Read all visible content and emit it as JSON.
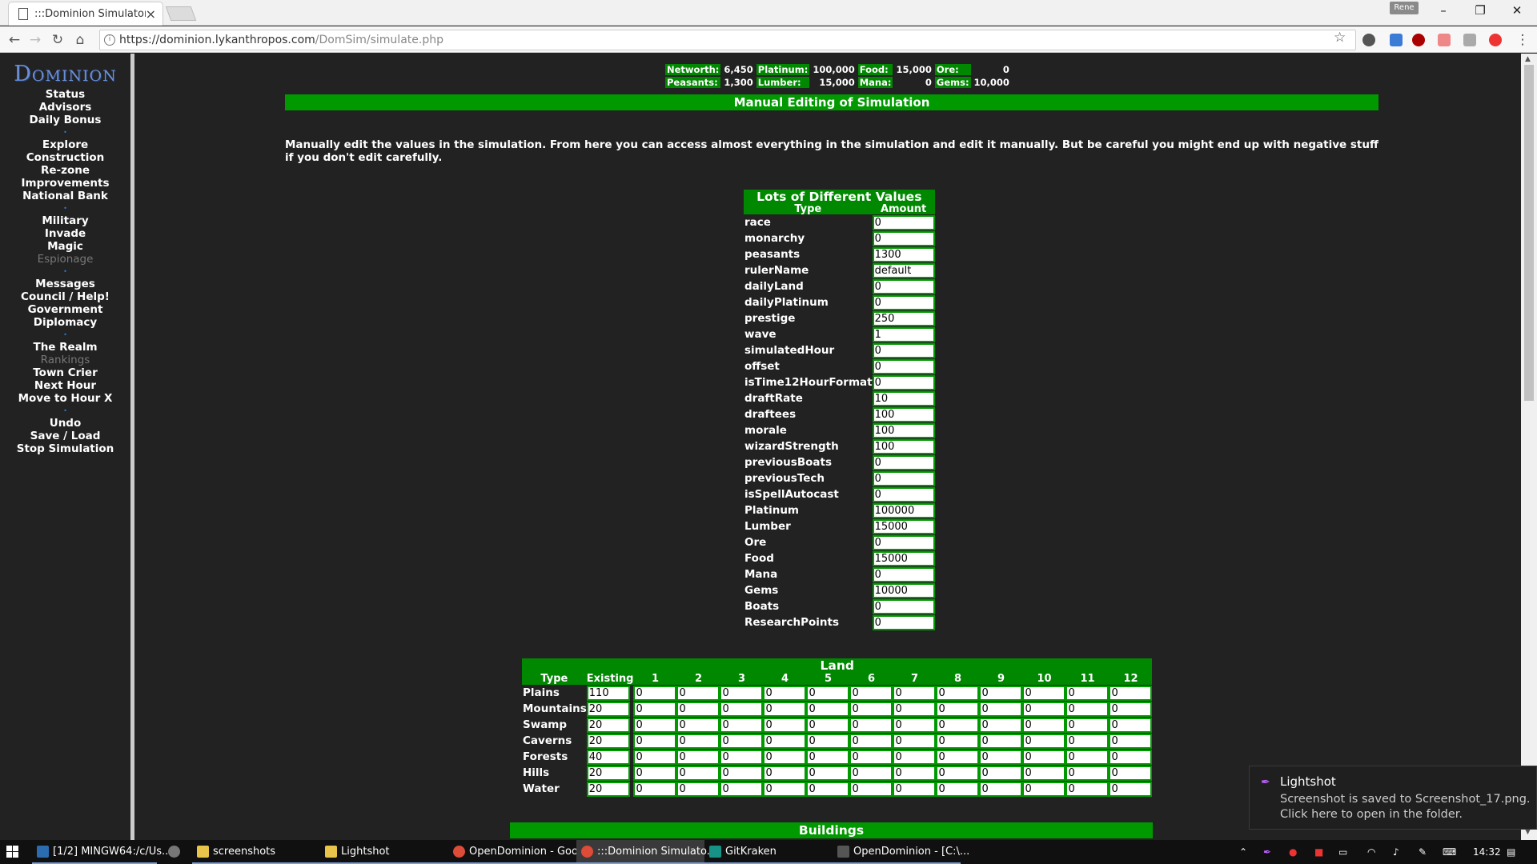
{
  "browser": {
    "tab_title": ":::Dominion Simulator:::",
    "tab_close": "×",
    "profile": "Rene",
    "url_host": "https://dominion.lykanthropos.com",
    "url_path": "/DomSim/simulate.php",
    "minimize": "–",
    "maximize": "❐",
    "close": "✕"
  },
  "sidebar": {
    "logo": "Dominion",
    "items": [
      "Status",
      "Advisors",
      "Daily Bonus",
      "Explore",
      "Construction",
      "Re-zone",
      "Improvements",
      "National Bank",
      "Military",
      "Invade",
      "Magic",
      "Espionage",
      "Messages",
      "Council / Help!",
      "Government",
      "Diplomacy",
      "The Realm",
      "Rankings",
      "Town Crier",
      "Next Hour",
      "Move to Hour X",
      "Undo",
      "Save / Load",
      "Stop Simulation"
    ]
  },
  "stats": {
    "networth_label": "Networth:",
    "networth": "6,450",
    "platinum_label": "Platinum:",
    "platinum": "100,000",
    "food_label": "Food:",
    "food": "15,000",
    "ore_label": "Ore:",
    "ore": "0",
    "peasants_label": "Peasants:",
    "peasants": "1,300",
    "lumber_label": "Lumber:",
    "lumber": "15,000",
    "mana_label": "Mana:",
    "mana": "0",
    "gems_label": "Gems:",
    "gems": "10,000"
  },
  "page": {
    "title": "Manual Editing of Simulation",
    "intro": "Manually edit the values in the simulation. From here you can access almost everything in the simulation and edit it manually. But be careful you might end up with negative stuff if you don't edit carefully."
  },
  "values_table": {
    "title": "Lots of Different Values",
    "col_type": "Type",
    "col_amount": "Amount",
    "rows": [
      {
        "name": "race",
        "value": "0"
      },
      {
        "name": "monarchy",
        "value": "0"
      },
      {
        "name": "peasants",
        "value": "1300"
      },
      {
        "name": "rulerName",
        "value": "default"
      },
      {
        "name": "dailyLand",
        "value": "0"
      },
      {
        "name": "dailyPlatinum",
        "value": "0"
      },
      {
        "name": "prestige",
        "value": "250"
      },
      {
        "name": "wave",
        "value": "1"
      },
      {
        "name": "simulatedHour",
        "value": "0"
      },
      {
        "name": "offset",
        "value": "0"
      },
      {
        "name": "isTime12HourFormat",
        "value": "0"
      },
      {
        "name": "draftRate",
        "value": "10"
      },
      {
        "name": "draftees",
        "value": "100"
      },
      {
        "name": "morale",
        "value": "100"
      },
      {
        "name": "wizardStrength",
        "value": "100"
      },
      {
        "name": "previousBoats",
        "value": "0"
      },
      {
        "name": "previousTech",
        "value": "0"
      },
      {
        "name": "isSpellAutocast",
        "value": "0"
      },
      {
        "name": "Platinum",
        "value": "100000"
      },
      {
        "name": "Lumber",
        "value": "15000"
      },
      {
        "name": "Ore",
        "value": "0"
      },
      {
        "name": "Food",
        "value": "15000"
      },
      {
        "name": "Mana",
        "value": "0"
      },
      {
        "name": "Gems",
        "value": "10000"
      },
      {
        "name": "Boats",
        "value": "0"
      },
      {
        "name": "ResearchPoints",
        "value": "0"
      }
    ]
  },
  "land_table": {
    "title": "Land",
    "headers": [
      "Type",
      "Existing",
      "1",
      "2",
      "3",
      "4",
      "5",
      "6",
      "7",
      "8",
      "9",
      "10",
      "11",
      "12"
    ],
    "rows": [
      {
        "name": "Plains",
        "values": [
          "110",
          "0",
          "0",
          "0",
          "0",
          "0",
          "0",
          "0",
          "0",
          "0",
          "0",
          "0",
          "0"
        ]
      },
      {
        "name": "Mountains",
        "values": [
          "20",
          "0",
          "0",
          "0",
          "0",
          "0",
          "0",
          "0",
          "0",
          "0",
          "0",
          "0",
          "0"
        ]
      },
      {
        "name": "Swamp",
        "values": [
          "20",
          "0",
          "0",
          "0",
          "0",
          "0",
          "0",
          "0",
          "0",
          "0",
          "0",
          "0",
          "0"
        ]
      },
      {
        "name": "Caverns",
        "values": [
          "20",
          "0",
          "0",
          "0",
          "0",
          "0",
          "0",
          "0",
          "0",
          "0",
          "0",
          "0",
          "0"
        ]
      },
      {
        "name": "Forests",
        "values": [
          "40",
          "0",
          "0",
          "0",
          "0",
          "0",
          "0",
          "0",
          "0",
          "0",
          "0",
          "0",
          "0"
        ]
      },
      {
        "name": "Hills",
        "values": [
          "20",
          "0",
          "0",
          "0",
          "0",
          "0",
          "0",
          "0",
          "0",
          "0",
          "0",
          "0",
          "0"
        ]
      },
      {
        "name": "Water",
        "values": [
          "20",
          "0",
          "0",
          "0",
          "0",
          "0",
          "0",
          "0",
          "0",
          "0",
          "0",
          "0",
          "0"
        ]
      }
    ]
  },
  "buildings_title": "Buildings",
  "toast": {
    "app": "Lightshot",
    "line1": "Screenshot is saved to Screenshot_17.png.",
    "line2": "Click here to open in the folder."
  },
  "taskbar": {
    "items": [
      "[1/2] MINGW64:/c/Us...",
      "screenshots",
      "Lightshot",
      "OpenDominion - Goo...",
      ":::Dominion Simulato...",
      "GitKraken",
      "OpenDominion - [C:\\..."
    ],
    "time": "14:32"
  },
  "colors": {
    "green": "#009900",
    "dark_bg": "#222222",
    "link_blue": "#6a8fd8"
  }
}
